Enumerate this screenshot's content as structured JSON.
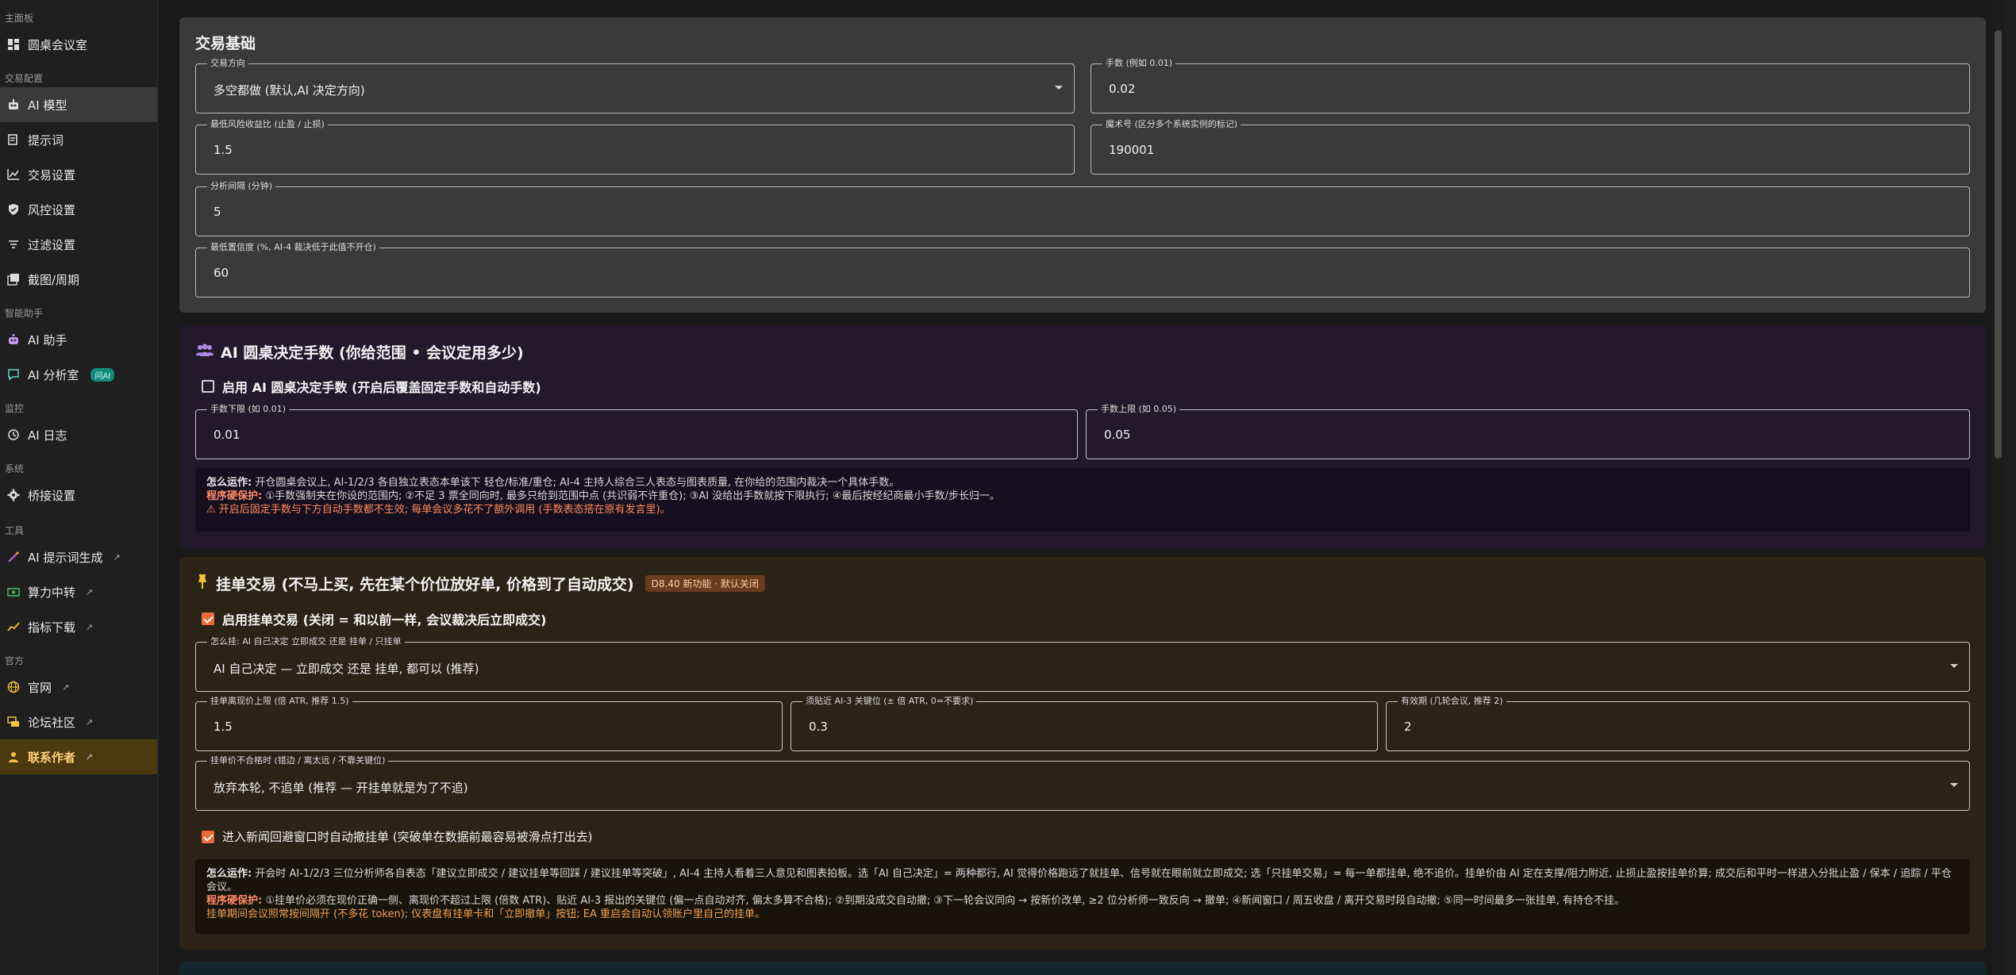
{
  "sidebar": {
    "sections": [
      {
        "label": "主面板",
        "items": [
          {
            "label": "圆桌会议室",
            "icon": "dashboard-icon"
          }
        ]
      },
      {
        "label": "交易配置",
        "items": [
          {
            "label": "AI 模型",
            "icon": "robot-icon"
          },
          {
            "label": "提示词",
            "icon": "note-edit-icon"
          },
          {
            "label": "交易设置",
            "icon": "chart-line-icon"
          },
          {
            "label": "风控设置",
            "icon": "shield-check-icon"
          },
          {
            "label": "过滤设置",
            "icon": "filter-icon"
          },
          {
            "label": "截图/周期",
            "icon": "gallery-icon"
          }
        ]
      },
      {
        "label": "智能助手",
        "items": [
          {
            "label": "AI 助手",
            "icon": "robot-assistant-icon"
          },
          {
            "label": "AI 分析室",
            "icon": "chat-icon",
            "tag": "问AI"
          }
        ]
      },
      {
        "label": "监控",
        "items": [
          {
            "label": "AI 日志",
            "icon": "history-icon"
          }
        ]
      },
      {
        "label": "系统",
        "items": [
          {
            "label": "桥接设置",
            "icon": "gear-icon"
          }
        ]
      },
      {
        "label": "工具",
        "items": [
          {
            "label": "AI 提示词生成",
            "icon": "magic-wand-icon"
          },
          {
            "label": "算力中转",
            "icon": "money-icon"
          },
          {
            "label": "指标下载",
            "icon": "trend-icon"
          }
        ]
      },
      {
        "label": "官方",
        "items": [
          {
            "label": "官网",
            "icon": "globe-icon"
          },
          {
            "label": "论坛社区",
            "icon": "forum-icon"
          },
          {
            "label": "联系作者",
            "icon": "contact-icon"
          }
        ]
      }
    ]
  },
  "card1": {
    "title": "交易基础",
    "direction": {
      "label": "交易方向",
      "value": "多空都做 (默认,AI 决定方向)"
    },
    "lots": {
      "label": "手数 (例如 0.01)",
      "value": "0.02"
    },
    "min_rr": {
      "label": "最低风险收益比 (止盈 / 止损)",
      "value": "1.5"
    },
    "magic": {
      "label": "魔术号 (区分多个系统实例的标记)",
      "value": "190001"
    },
    "interval": {
      "label": "分析间隔 (分钟)",
      "value": "5"
    },
    "min_conf": {
      "label": "最低置信度 (%, AI-4 裁决低于此值不开仓)",
      "value": "60"
    }
  },
  "card2": {
    "title": "AI 圆桌决定手数 (你给范围 • 会议定用多少)",
    "enable": "启用 AI 圆桌决定手数 (开启后覆盖固定手数和自动手数)",
    "lot_min": {
      "label": "手数下限 (如 0.01)",
      "value": "0.01"
    },
    "lot_max": {
      "label": "手数上限 (如 0.05)",
      "value": "0.05"
    },
    "how_h": "怎么运作:",
    "how": "开仓圆桌会议上, AI-1/2/3 各自独立表态本单该下 轻仓/标准/重仓; AI-4 主持人综合三人表态与图表质量, 在你给的范围内裁决一个具体手数。",
    "guard_h": "程序硬保护:",
    "guard": "①手数强制夹在你设的范围内; ②不足 3 票全同向时, 最多只给到范围中点 (共识弱不许重仓); ③AI 没给出手数就按下限执行; ④最后按经纪商最小手数/步长归一。",
    "warn": "⚠ 开启后固定手数与下方自动手数都不生效; 每单会议多花不了额外调用 (手数表态搭在原有发言里)。"
  },
  "card3": {
    "title": "挂单交易 (不马上买, 先在某个价位放好单, 价格到了自动成交)",
    "badge": "D8.40 新功能 · 默认关闭",
    "enable": "启用挂单交易 (关闭 = 和以前一样, 会议裁决后立即成交)",
    "mode": {
      "label": "怎么挂: AI 自己决定 立即成交 还是 挂单 / 只挂单",
      "value": "AI 自己决定 — 立即成交 还是 挂单, 都可以 (推荐)"
    },
    "max_dist": {
      "label": "挂单离现价上限 (倍 ATR, 推荐 1.5)",
      "value": "1.5"
    },
    "near_key": {
      "label": "须贴近 AI-3 关键位 (± 倍 ATR, 0=不要求)",
      "value": "0.3"
    },
    "expiry": {
      "label": "有效期 (几轮会议, 推荐 2)",
      "value": "2"
    },
    "bad_price": {
      "label": "挂单价不合格时 (错边 / 离太远 / 不靠关键位)",
      "value": "放弃本轮, 不追单 (推荐 — 开挂单就是为了不追)"
    },
    "news": "进入新闻回避窗口时自动撤挂单 (突破单在数据前最容易被滑点打出去)",
    "how_h": "怎么运作:",
    "how": "开会时 AI-1/2/3 三位分析师各自表态「建议立即成交 / 建议挂单等回踩 / 建议挂单等突破」, AI-4 主持人看着三人意见和图表拍板。选「AI 自己决定」= 两种都行, AI 觉得价格跑远了就挂单、信号就在眼前就立即成交; 选「只挂单交易」= 每一单都挂单, 绝不追价。挂单价由 AI 定在支撑/阻力附近, 止损止盈按挂单价算; 成交后和平时一样进入分批止盈 / 保本 / 追踪 / 平仓会议。",
    "guard_h": "程序硬保护:",
    "guard": "①挂单价必须在现价正确一侧、离现价不超过上限 (倍数 ATR)、贴近 AI-3 报出的关键位 (偏一点自动对齐, 偏太多算不合格); ②到期没成交自动撤; ③下一轮会议同向 → 按新价改单, ≥2 位分析师一致反向 → 撤单; ④新闻窗口 / 周五收盘 / 离开交易时段自动撤; ⑤同一时间最多一张挂单, 有持仓不挂。",
    "tail": "挂单期间会议照常按间隔开 (不多花 token); 仪表盘有挂单卡和「立即撤单」按钮; EA 重启会自动认领账户里自己的挂单。"
  },
  "colors": {
    "accent": "#ef6a3a",
    "sidebar_bg": "#1f1f1f",
    "active_bg": "#3a3a3a"
  }
}
